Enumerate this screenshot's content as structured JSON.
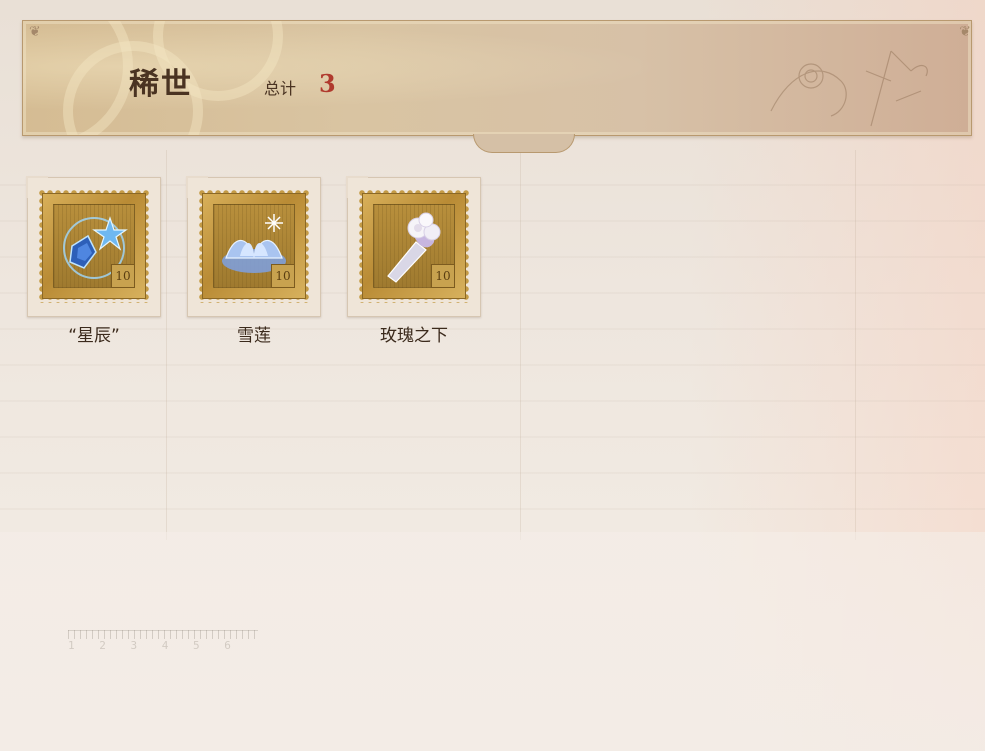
{
  "header": {
    "title": "稀世",
    "total_label": "总计",
    "total_value": "3"
  },
  "items": [
    {
      "name": "“星辰”",
      "art": "star-crystal-icon"
    },
    {
      "name": "雪莲",
      "art": "snow-lotus-icon"
    },
    {
      "name": "玫瑰之下",
      "art": "white-rose-bouquet-icon"
    }
  ],
  "stamp_denomination": "10",
  "ruler_digits": "1 2 3 4 5 6",
  "colors": {
    "banner": "#d7c1a7",
    "title_text": "#4a3322",
    "total_value": "#b03a2e",
    "stamp_gold": "#c49b46"
  }
}
